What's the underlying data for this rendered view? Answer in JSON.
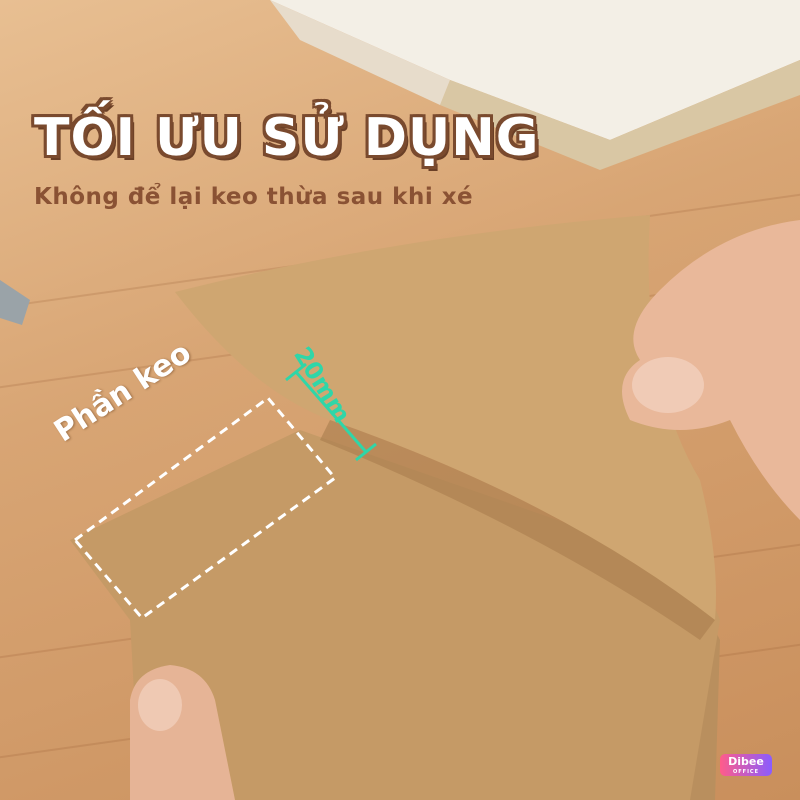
{
  "headline": "TỐI ƯU SỬ DỤNG",
  "subheadline": "Không để lại keo thừa sau khi xé",
  "glue_area_label": "Phần keo",
  "glue_strip_width_label": "20mm",
  "brand_logo": {
    "name": "Dibee",
    "tagline": "OFFICE"
  },
  "colors": {
    "headline_fill": "#ffffff",
    "headline_outline": "#7a4a2e",
    "subheadline": "#8a5234",
    "measure": "#2fd6a8",
    "kraft_paper": "#c9a06a"
  }
}
